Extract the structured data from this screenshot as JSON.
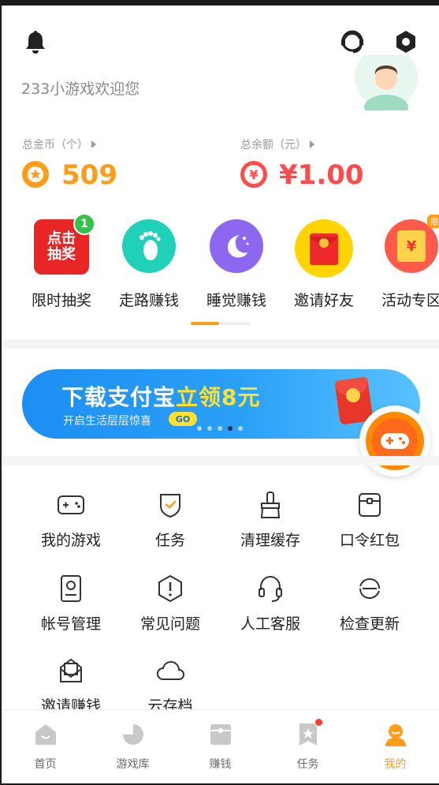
{
  "header": {
    "welcome": "233小游戏欢迎您",
    "icons": [
      "bell-icon",
      "customer-service-icon",
      "settings-icon"
    ]
  },
  "stats": {
    "gold": {
      "label": "总金币（个）",
      "value": "509",
      "color": "#ff9c1a"
    },
    "balance": {
      "label": "总余额（元）",
      "value": "¥1.00",
      "color": "#ff4b4b",
      "icon_text": "¥"
    }
  },
  "quick_actions": [
    {
      "label": "限时抽奖",
      "icon": "lottery-icon",
      "icon_text_1": "点击",
      "icon_text_2": "抽奖",
      "badge": "1"
    },
    {
      "label": "走路赚钱",
      "icon": "footprint-icon"
    },
    {
      "label": "睡觉赚钱",
      "icon": "moon-icon"
    },
    {
      "label": "邀请好友",
      "icon": "red-envelope-icon"
    },
    {
      "label": "活动专区",
      "icon": "activity-icon",
      "badge": "限时",
      "icon_text": "¥"
    }
  ],
  "banner": {
    "title_part1": "下载支付宝",
    "title_highlight": "立领8元",
    "subtitle": "开启生活层层惊喜",
    "go": "GO",
    "page_count": 5,
    "active_index": 3
  },
  "grid": [
    {
      "label": "我的游戏",
      "icon": "gamepad-icon"
    },
    {
      "label": "任务",
      "icon": "shield-check-icon"
    },
    {
      "label": "清理缓存",
      "icon": "brush-icon"
    },
    {
      "label": "口令红包",
      "icon": "envelope-icon"
    },
    {
      "label": "帐号管理",
      "icon": "account-icon"
    },
    {
      "label": "常见问题",
      "icon": "question-icon"
    },
    {
      "label": "人工客服",
      "icon": "headset-icon"
    },
    {
      "label": "检查更新",
      "icon": "refresh-icon"
    },
    {
      "label": "邀请赚钱",
      "icon": "invite-icon"
    },
    {
      "label": "云存档",
      "icon": "cloud-icon"
    }
  ],
  "tabs": [
    {
      "label": "首页",
      "icon": "home-icon",
      "active": false
    },
    {
      "label": "游戏库",
      "icon": "game-library-icon",
      "active": false
    },
    {
      "label": "赚钱",
      "icon": "earn-icon",
      "active": false
    },
    {
      "label": "任务",
      "icon": "task-icon",
      "active": false,
      "dot": true
    },
    {
      "label": "我的",
      "icon": "profile-icon",
      "active": true
    }
  ],
  "colors": {
    "accent": "#ff9c1a",
    "red": "#ff4b4b",
    "banner_blue": "#1d8ef3",
    "highlight_yellow": "#ffe02a"
  }
}
